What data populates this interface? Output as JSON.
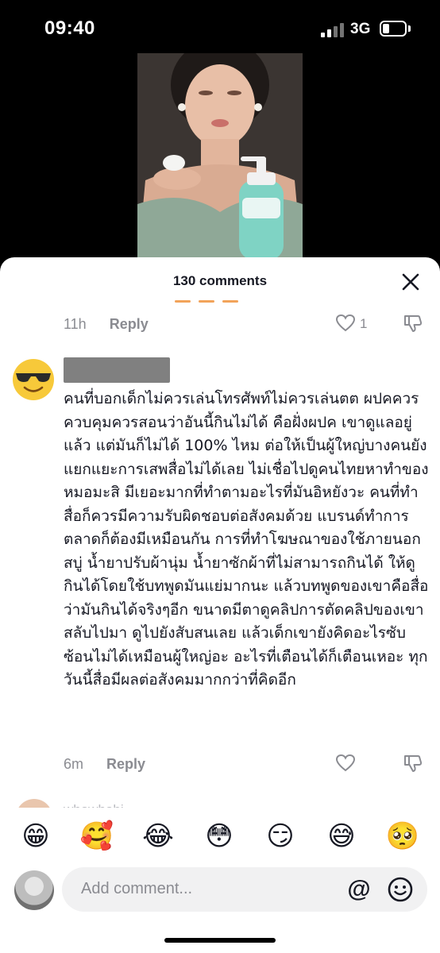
{
  "status_bar": {
    "time": "09:40",
    "network": "3G",
    "battery_level": 0.2
  },
  "sheet": {
    "title": "130 comments"
  },
  "prev_comment": {
    "time": "11h",
    "reply_label": "Reply",
    "likes": "1"
  },
  "comment": {
    "avatar_emoji": "😎",
    "text": "คนที่บอกเด็กไม่ควรเล่นโทรศัพท์ไม่ควรเล่นตต ผปคควรควบคุมควรสอนว่าอันนี้กินไม่ได้ คือฝั่งผปค เขาดูแลอยู่แล้ว แต่มันก็ไม่ได้ 100% ไหม ต่อให้เป็นผู้ใหญ่บางคนยังแยกแยะการเสพสื่อไม่ได้เลย ไม่เชื่อไปดูคนไทยหาทำของหมอมะสิ มีเยอะมากที่ทำตามอะไรที่มันอิหยังวะ คนที่ทำสื่อก็ควรมีความรับผิดชอบต่อสังคมด้วย แบรนด์ทำการตลาดก็ต้องมีเหมือนกัน การที่ทำโฆษณาของใช้ภายนอก สบู่ น้ำยาปรับผ้านุ่ม น้ำยาซักผ้าที่ไม่สามารถกินได้ ให้ดูกินได้โดยใช้บทพูดมันแย่มากนะ แล้วบทพูดของเขาคือสื่อว่ามันกินได้จริงๆอีก ขนาดมีตาดูคลิปการตัดคลิปของเขาสลับไปมา ดูไปยังสับสนเลย แล้วเด็กเขายังคิดอะไรซับซ้อนไม่ได้เหมือนผู้ใหญ่อะ อะไรที่เตือนได้ก็เตือนเหอะ ทุกวันนี้สื่อมีผลต่อสังคมมากกว่าที่คิดอีก",
    "time": "6m",
    "reply_label": "Reply"
  },
  "next_comment": {
    "username": "whowhobi"
  },
  "emoji_bar": [
    "😁",
    "🥰",
    "😂",
    "😳",
    "😏",
    "😅",
    "🥺"
  ],
  "compose": {
    "placeholder": "Add comment...",
    "mention_symbol": "@"
  },
  "icons": {
    "close": "close-icon",
    "like": "heart-outline-icon",
    "dislike": "thumbs-down-icon",
    "emoji_picker": "smile-icon"
  }
}
